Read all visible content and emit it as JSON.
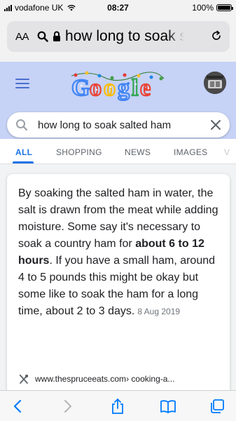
{
  "status_bar": {
    "carrier": "vodafone UK",
    "time": "08:27",
    "battery": "100%"
  },
  "address_bar": {
    "aa_label": "AA",
    "url_text": "how long to soak s"
  },
  "google": {
    "search_query": "how long to soak salted ham",
    "tabs": [
      "ALL",
      "SHOPPING",
      "NEWS",
      "IMAGES"
    ]
  },
  "result": {
    "snippet_part1": "By soaking the salted ham in water, the salt is drawn from the meat while adding moisture. Some say it's necessary to soak a country ham for ",
    "snippet_bold": "about 6 to 12 hours",
    "snippet_part2": ". If you have a small ham, around 4 to 5 pounds this might be okay but some like to soak the ham for a long time, about 2 to 3 days.",
    "date": "8 Aug 2019",
    "source_domain": "www.thespruceeats.com",
    "source_path": " › cooking-a..."
  },
  "colors": {
    "google_header_bg": "#c6d2f6",
    "active_tab": "#1a73e8",
    "ios_blue": "#007aff"
  }
}
